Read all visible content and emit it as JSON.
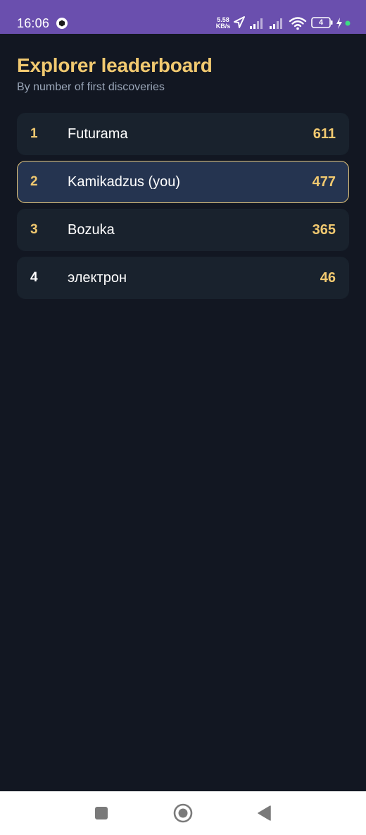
{
  "status_bar": {
    "time": "16:06",
    "network_speed_value": "5.58",
    "network_speed_unit": "KB/s",
    "battery_level": "4",
    "icons": [
      "app-notification-icon",
      "location-arrow-icon",
      "signal-icon",
      "signal-icon",
      "wifi-icon",
      "battery-icon",
      "charging-bolt-icon",
      "privacy-dot-icon"
    ],
    "color": "#6a4fae"
  },
  "header": {
    "title": "Explorer leaderboard",
    "subtitle": "By number of first discoveries"
  },
  "leaderboard": [
    {
      "rank": "1",
      "name": "Futurama",
      "score": "611",
      "is_you": false
    },
    {
      "rank": "2",
      "name": "Kamikadzus (you)",
      "score": "477",
      "is_you": true
    },
    {
      "rank": "3",
      "name": "Bozuka",
      "score": "365",
      "is_you": false
    },
    {
      "rank": "4",
      "name": "электрон",
      "score": "46",
      "is_you": false
    }
  ],
  "navigation_bar": {
    "buttons": [
      "recents-square-icon",
      "home-circle-icon",
      "back-triangle-icon"
    ]
  },
  "colors": {
    "background": "#121722",
    "accent": "#f1c970",
    "row_background": "#19222d",
    "highlight_row_background": "#253450",
    "highlight_border": "#e4c57a",
    "subtitle": "#9aa6b8"
  }
}
